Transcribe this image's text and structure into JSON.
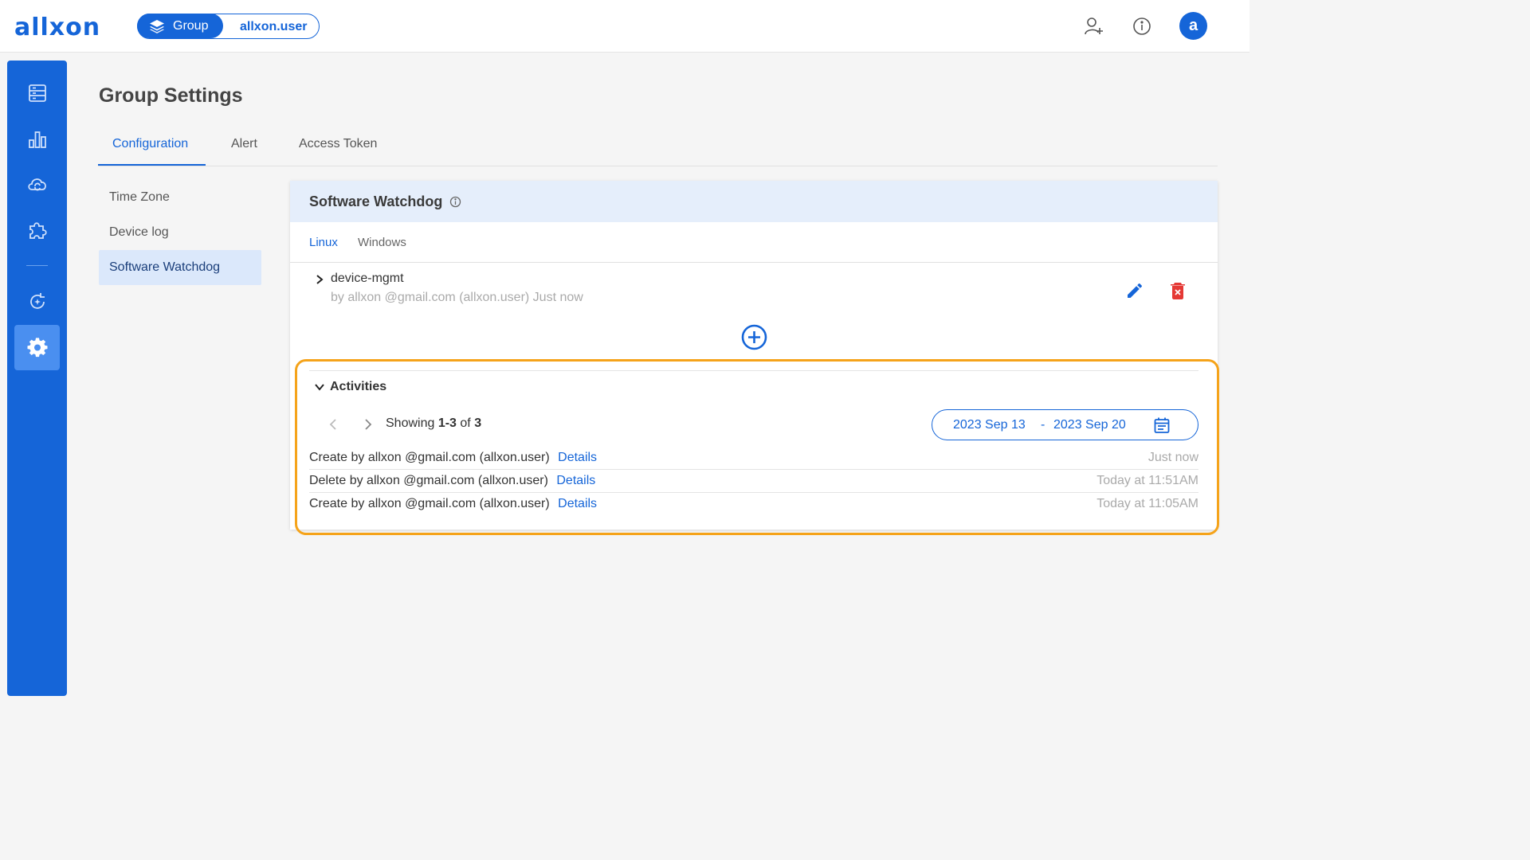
{
  "app": {
    "logo": "allxon"
  },
  "topbar": {
    "group_label": "Group",
    "user_label": "allxon.user",
    "avatar_letter": "a"
  },
  "nav": {
    "items": [
      {
        "icon": "server-icon"
      },
      {
        "icon": "bar-chart-icon"
      },
      {
        "icon": "cloud-sync-icon"
      },
      {
        "icon": "puzzle-icon"
      },
      {
        "icon": "refresh-icon"
      },
      {
        "icon": "gear-icon",
        "active": true
      }
    ]
  },
  "page": {
    "title": "Group Settings"
  },
  "tabs": [
    {
      "label": "Configuration",
      "active": true
    },
    {
      "label": "Alert"
    },
    {
      "label": "Access Token"
    }
  ],
  "side_menu": [
    {
      "label": "Time Zone"
    },
    {
      "label": "Device log"
    },
    {
      "label": "Software Watchdog",
      "active": true
    }
  ],
  "card": {
    "title": "Software Watchdog",
    "os_tabs": [
      {
        "label": "Linux",
        "active": true
      },
      {
        "label": "Windows"
      }
    ],
    "watchdog_item": {
      "name": "device-mgmt",
      "meta": "by allxon @gmail.com (allxon.user) Just now"
    }
  },
  "activities": {
    "title": "Activities",
    "showing_prefix": "Showing",
    "range": "1-3",
    "of_word": "of",
    "total": "3",
    "date_from": "2023 Sep 13",
    "date_dash": "-",
    "date_to": "2023 Sep 20",
    "rows": [
      {
        "text": "Create by allxon @gmail.com (allxon.user)",
        "link": "Details",
        "time": "Just now"
      },
      {
        "text": "Delete by allxon @gmail.com (allxon.user)",
        "link": "Details",
        "time": "Today at 11:51AM"
      },
      {
        "text": "Create by allxon @gmail.com (allxon.user)",
        "link": "Details",
        "time": "Today at 11:05AM"
      }
    ]
  },
  "colors": {
    "brand": "#1565d8",
    "highlight": "#f5a31a",
    "delete": "#e53935"
  }
}
